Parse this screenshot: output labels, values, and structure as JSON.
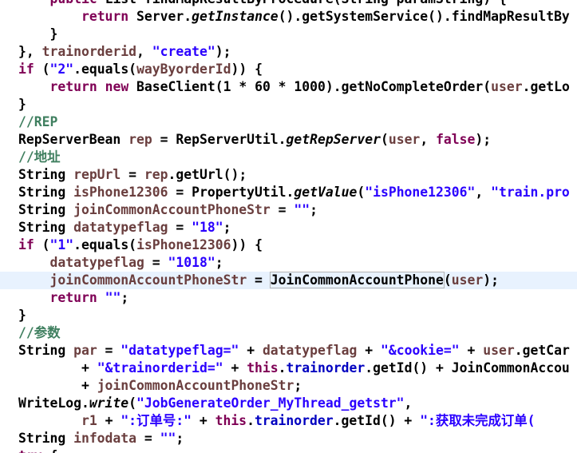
{
  "editor": {
    "lines": [
      {
        "tokens": [
          [
            "plain",
            "    "
          ],
          [
            "kw",
            "public"
          ],
          [
            "plain",
            " List findMapResultByProcedure(String paramString) {"
          ]
        ]
      },
      {
        "tokens": [
          [
            "plain",
            "        "
          ],
          [
            "kw",
            "return"
          ],
          [
            "plain",
            " Server."
          ],
          [
            "method",
            "getInstance"
          ],
          [
            "plain",
            "().getSystemService().findMapResultBy"
          ]
        ]
      },
      {
        "tokens": [
          [
            "plain",
            "    }"
          ]
        ]
      },
      {
        "tokens": [
          [
            "plain",
            "}, "
          ],
          [
            "var",
            "trainorderid"
          ],
          [
            "plain",
            ", "
          ],
          [
            "str",
            "\"create\""
          ],
          [
            "plain",
            ");"
          ]
        ]
      },
      {
        "tokens": [
          [
            "kw",
            "if"
          ],
          [
            "plain",
            " ("
          ],
          [
            "str",
            "\"2\""
          ],
          [
            "plain",
            ".equals("
          ],
          [
            "var",
            "wayByorderId"
          ],
          [
            "plain",
            ")) {"
          ]
        ]
      },
      {
        "tokens": [
          [
            "plain",
            "    "
          ],
          [
            "kw",
            "return"
          ],
          [
            "plain",
            " "
          ],
          [
            "kw",
            "new"
          ],
          [
            "plain",
            " BaseClient(1 * 60 * 1000).getNoCompleteOrder("
          ],
          [
            "var",
            "user"
          ],
          [
            "plain",
            ".getLo"
          ]
        ]
      },
      {
        "tokens": [
          [
            "plain",
            "}"
          ]
        ]
      },
      {
        "tokens": [
          [
            "comment",
            "//REP"
          ]
        ]
      },
      {
        "tokens": [
          [
            "plain",
            "RepServerBean "
          ],
          [
            "var",
            "rep"
          ],
          [
            "plain",
            " = RepServerUtil."
          ],
          [
            "method",
            "getRepServer"
          ],
          [
            "plain",
            "("
          ],
          [
            "var",
            "user"
          ],
          [
            "plain",
            ", "
          ],
          [
            "kw",
            "false"
          ],
          [
            "plain",
            ");"
          ]
        ]
      },
      {
        "tokens": [
          [
            "comment",
            "//地址"
          ]
        ]
      },
      {
        "tokens": [
          [
            "plain",
            "String "
          ],
          [
            "var",
            "repUrl"
          ],
          [
            "plain",
            " = "
          ],
          [
            "var",
            "rep"
          ],
          [
            "plain",
            ".getUrl();"
          ]
        ]
      },
      {
        "tokens": [
          [
            "plain",
            "String "
          ],
          [
            "var",
            "isPhone12306"
          ],
          [
            "plain",
            " = PropertyUtil."
          ],
          [
            "method",
            "getValue"
          ],
          [
            "plain",
            "("
          ],
          [
            "str",
            "\"isPhone12306\""
          ],
          [
            "plain",
            ", "
          ],
          [
            "str",
            "\"train.pro"
          ]
        ]
      },
      {
        "tokens": [
          [
            "plain",
            "String "
          ],
          [
            "var",
            "joinCommonAccountPhoneStr"
          ],
          [
            "plain",
            " = "
          ],
          [
            "str",
            "\"\""
          ],
          [
            "plain",
            ";"
          ]
        ]
      },
      {
        "tokens": [
          [
            "plain",
            "String "
          ],
          [
            "var",
            "datatypeflag"
          ],
          [
            "plain",
            " = "
          ],
          [
            "str",
            "\"18\""
          ],
          [
            "plain",
            ";"
          ]
        ]
      },
      {
        "tokens": [
          [
            "kw",
            "if"
          ],
          [
            "plain",
            " ("
          ],
          [
            "str",
            "\"1\""
          ],
          [
            "plain",
            ".equals("
          ],
          [
            "var",
            "isPhone12306"
          ],
          [
            "plain",
            ")) {"
          ]
        ]
      },
      {
        "tokens": [
          [
            "plain",
            "    "
          ],
          [
            "var",
            "datatypeflag"
          ],
          [
            "plain",
            " = "
          ],
          [
            "str",
            "\"1018\""
          ],
          [
            "plain",
            ";"
          ]
        ]
      },
      {
        "highlight": true,
        "tokens": [
          [
            "plain",
            "    "
          ],
          [
            "var",
            "joinCommonAccountPhoneStr"
          ],
          [
            "plain",
            " = "
          ],
          [
            "boxed",
            "JoinCommonAccountPhone"
          ],
          [
            "plain",
            "("
          ],
          [
            "var",
            "user"
          ],
          [
            "plain",
            ");"
          ]
        ]
      },
      {
        "tokens": [
          [
            "plain",
            "    "
          ],
          [
            "kw",
            "return"
          ],
          [
            "plain",
            " "
          ],
          [
            "str",
            "\"\""
          ],
          [
            "plain",
            ";"
          ]
        ]
      },
      {
        "tokens": [
          [
            "plain",
            "}"
          ]
        ]
      },
      {
        "tokens": [
          [
            "comment",
            "//参数"
          ]
        ]
      },
      {
        "tokens": [
          [
            "plain",
            "String "
          ],
          [
            "var",
            "par"
          ],
          [
            "plain",
            " = "
          ],
          [
            "str",
            "\"datatypeflag=\""
          ],
          [
            "plain",
            " + "
          ],
          [
            "var",
            "datatypeflag"
          ],
          [
            "plain",
            " + "
          ],
          [
            "str",
            "\"&cookie=\""
          ],
          [
            "plain",
            " + "
          ],
          [
            "var",
            "user"
          ],
          [
            "plain",
            ".getCar"
          ]
        ]
      },
      {
        "tokens": [
          [
            "plain",
            "        + "
          ],
          [
            "str",
            "\"&trainorderid=\""
          ],
          [
            "plain",
            " + "
          ],
          [
            "kw",
            "this"
          ],
          [
            "plain",
            "."
          ],
          [
            "field",
            "trainorder"
          ],
          [
            "plain",
            ".getId() + JoinCommonAccou"
          ]
        ]
      },
      {
        "tokens": [
          [
            "plain",
            "        + "
          ],
          [
            "var",
            "joinCommonAccountPhoneStr"
          ],
          [
            "plain",
            ";"
          ]
        ]
      },
      {
        "tokens": [
          [
            "plain",
            "WriteLog."
          ],
          [
            "method",
            "write"
          ],
          [
            "plain",
            "("
          ],
          [
            "str",
            "\"JobGenerateOrder_MyThread_getstr\""
          ],
          [
            "plain",
            ","
          ]
        ]
      },
      {
        "tokens": [
          [
            "plain",
            "        "
          ],
          [
            "var",
            "r1"
          ],
          [
            "plain",
            " + "
          ],
          [
            "str",
            "\":订单号:\""
          ],
          [
            "plain",
            " + "
          ],
          [
            "kw",
            "this"
          ],
          [
            "plain",
            "."
          ],
          [
            "field",
            "trainorder"
          ],
          [
            "plain",
            ".getId() + "
          ],
          [
            "str",
            "\":获取未完成订单("
          ]
        ]
      },
      {
        "tokens": [
          [
            "plain",
            "String "
          ],
          [
            "var",
            "infodata"
          ],
          [
            "plain",
            " = "
          ],
          [
            "str",
            "\"\""
          ],
          [
            "plain",
            ";"
          ]
        ]
      },
      {
        "tokens": [
          [
            "kw",
            "try"
          ],
          [
            "plain",
            " {"
          ]
        ]
      }
    ]
  }
}
